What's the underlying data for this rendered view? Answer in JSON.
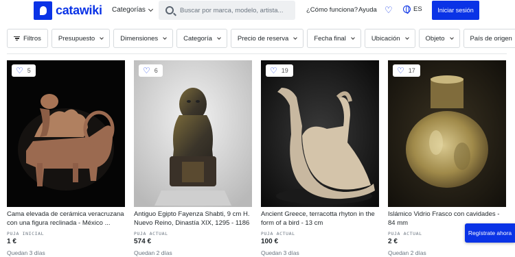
{
  "header": {
    "logo_text": "catawiki",
    "categories_label": "Categorías",
    "search_placeholder": "Buscar por marca, modelo, artista...",
    "how_it_works": "¿Cómo funciona?",
    "help": "Ayuda",
    "language": "ES",
    "login_button": "Iniciar sesión"
  },
  "filters": [
    {
      "label": "Filtros",
      "icon": "filter-icon"
    },
    {
      "label": "Presupuesto"
    },
    {
      "label": "Dimensiones"
    },
    {
      "label": "Categoría"
    },
    {
      "label": "Precio de reserva"
    },
    {
      "label": "Fecha final"
    },
    {
      "label": "Ubicación"
    },
    {
      "label": "Objeto"
    },
    {
      "label": "País de origen"
    }
  ],
  "lots": [
    {
      "favorites": "5",
      "title": "Cama elevada de cerámica veracruzana con una figura reclinada - México ...",
      "bid_label": "PUJA INICIAL",
      "bid_value": "1 €",
      "time_left": "Quedan 3 días"
    },
    {
      "favorites": "6",
      "title": "Antiguo Egipto Fayenza Shabti, 9 cm H. Nuevo Reino, Dinastía XIX, 1295 - 1186 ...",
      "bid_label": "PUJA ACTUAL",
      "bid_value": "574 €",
      "time_left": "Quedan 2 días"
    },
    {
      "favorites": "19",
      "title": "Ancient Greece, terracotta rhyton in the form of a bird - 13 cm",
      "bid_label": "PUJA ACTUAL",
      "bid_value": "100 €",
      "time_left": "Quedan 3 días"
    },
    {
      "favorites": "17",
      "title": "Islámico Vidrio Frasco con cavidades - 84 mm",
      "bid_label": "PUJA ACTUAL",
      "bid_value": "2 €",
      "time_left": "Quedan 2 días"
    }
  ],
  "register_button": "Regístrate ahora",
  "colors": {
    "brand": "#0a33e6"
  }
}
